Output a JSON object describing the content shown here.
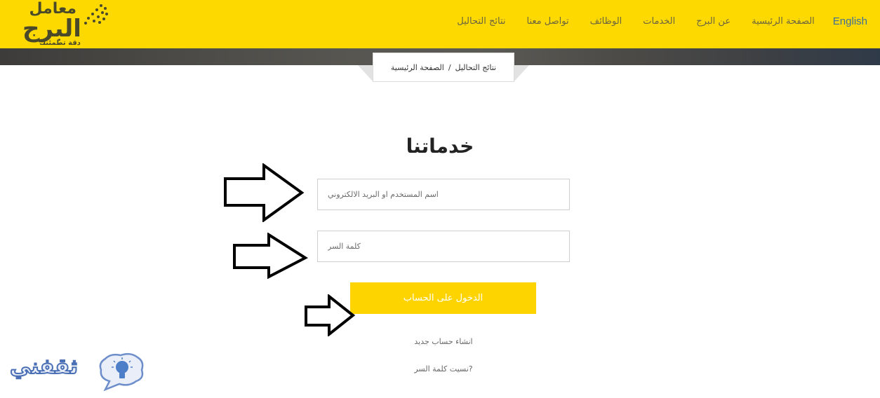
{
  "header": {
    "logo": {
      "name": "معامل",
      "brand": "البرج",
      "tagline": "دقة تطمئنك"
    },
    "nav": [
      {
        "label": "English",
        "lang": "en"
      },
      {
        "label": "الصفحة الرئيسية"
      },
      {
        "label": "عن البرج"
      },
      {
        "label": "الخدمات"
      },
      {
        "label": "الوظائف"
      },
      {
        "label": "تواصل معنا"
      },
      {
        "label": "نتائج التحاليل"
      }
    ],
    "colors": {
      "brand_yellow": "#fdd900",
      "english_link": "#3f6d9a"
    }
  },
  "breadcrumb": {
    "items": [
      "نتائج التحاليل",
      "الصفحة الرئيسية"
    ],
    "separator": "/"
  },
  "main": {
    "title": "خدماتنا",
    "username": {
      "placeholder": "اسم المستخدم او البريد الالكتروني",
      "value": ""
    },
    "password": {
      "placeholder": "كلمة السر",
      "value": ""
    },
    "login_button": "الدخول على الحساب",
    "register_link": "انشاء حساب جديد",
    "forgot_link": "?نسيت كلمة السر",
    "button_color": "#fdd400"
  },
  "annotations": {
    "arrows": [
      "arrow-to-username",
      "arrow-to-password",
      "arrow-to-login-button"
    ]
  },
  "watermark": {
    "text": "ثقفني",
    "icon": "lightbulb-speech-bubble-icon"
  }
}
